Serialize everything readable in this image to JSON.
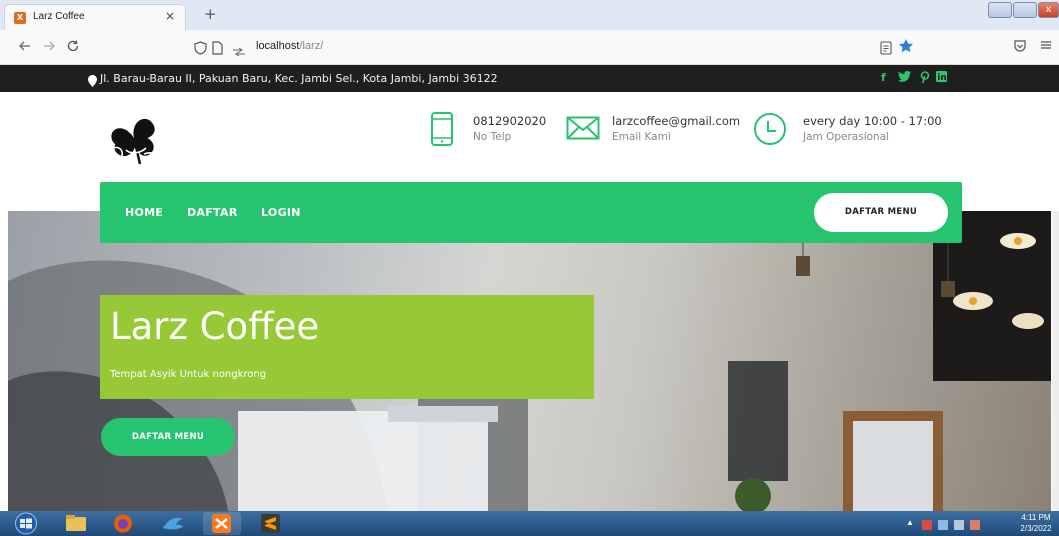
{
  "browser": {
    "tab_title": "Larz Coffee",
    "tab_close": "×",
    "new_tab": "+",
    "url_host": "localhost",
    "url_path": "/larz/",
    "favicon_text": "X",
    "close_glyph": "x",
    "accent": "#2b7fd6"
  },
  "topbar": {
    "address": "Jl. Barau-Barau II, Pakuan Baru, Kec. Jambi Sel., Kota Jambi, Jambi 36122",
    "social": [
      "f",
      "t",
      "p",
      "in"
    ]
  },
  "header": {
    "phone": {
      "value": "0812902020",
      "label": "No Telp"
    },
    "email": {
      "value": "larzcoffee@gmail.com",
      "label": "Email Kami"
    },
    "hours": {
      "value": "every day 10:00 - 17:00",
      "label": "Jam Operasional"
    }
  },
  "nav": {
    "home": "HOME",
    "daftar": "DAFTAR",
    "login": "LOGIN",
    "menu_button": "DAFTAR MENU",
    "color": "#27c46f"
  },
  "hero": {
    "title": "Larz Coffee",
    "subtitle": "Tempat Asyik Untuk nongkrong",
    "button": "DAFTAR MENU",
    "box_color": "#96c935"
  },
  "taskbar": {
    "time": "4:11 PM",
    "date": "2/3/2022",
    "tray_arrow": "▲"
  }
}
